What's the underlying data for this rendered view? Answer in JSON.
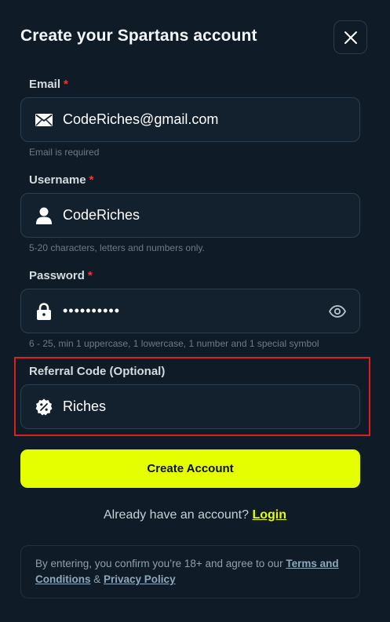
{
  "dialog": {
    "title": "Create your Spartans account"
  },
  "email": {
    "label": "Email",
    "required_mark": "*",
    "value": "CodeRiches@gmail.com",
    "hint": "Email is required",
    "icon": "envelope-icon"
  },
  "username": {
    "label": "Username",
    "required_mark": "*",
    "value": "CodeRiches",
    "hint": "5-20 characters, letters and numbers only.",
    "icon": "user-icon"
  },
  "password": {
    "label": "Password",
    "required_mark": "*",
    "value": "••••••••••",
    "hint": "6 - 25, min 1 uppercase, 1 lowercase, 1 number and 1 special symbol",
    "icon": "lock-icon"
  },
  "referral": {
    "label": "Referral Code (Optional)",
    "value": "Riches",
    "icon": "discount-badge-icon"
  },
  "actions": {
    "create_label": "Create Account",
    "login_prompt": "Already have an account?",
    "login_label": "Login"
  },
  "terms": {
    "text_before": "By entering, you confirm you’re 18+ and agree to our ",
    "terms_link": "Terms and Conditions",
    "joiner": " & ",
    "privacy_link": "Privacy Policy"
  },
  "colors": {
    "background": "#0f1b26",
    "accent": "#e6ff00",
    "required": "#e8383d",
    "highlight": "#e01e1e"
  }
}
